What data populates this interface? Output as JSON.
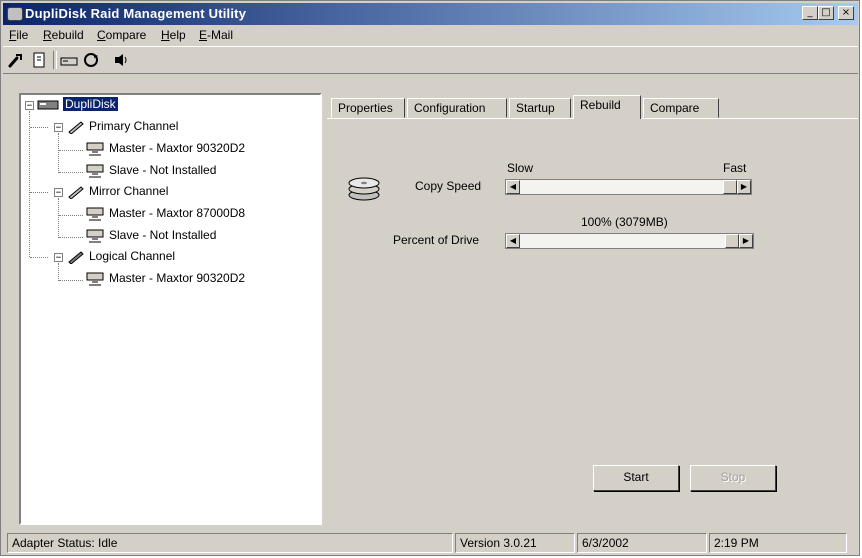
{
  "window": {
    "title": "DupliDisk Raid Management Utility",
    "minimize_glyph": "_",
    "maximize_glyph": "□",
    "close_glyph": "×"
  },
  "menu": [
    {
      "label": "File",
      "accel": "F",
      "rest": "ile"
    },
    {
      "label": "Rebuild",
      "accel": "R",
      "rest": "ebuild"
    },
    {
      "label": "Compare",
      "accel": "C",
      "rest": "ompare"
    },
    {
      "label": "Help",
      "accel": "H",
      "rest": "elp"
    },
    {
      "label": "E-Mail",
      "accel": "E",
      "rest": "-Mail"
    }
  ],
  "toolbar": {
    "icons": [
      "wrench-icon",
      "document-icon",
      "drive-icon",
      "refresh-icon",
      "speaker-icon"
    ]
  },
  "tree": {
    "root": "DupliDisk",
    "channels": [
      {
        "label": "Primary Channel",
        "children": [
          "Master - Maxtor 90320D2",
          "Slave - Not Installed"
        ]
      },
      {
        "label": "Mirror Channel",
        "children": [
          "Master - Maxtor 87000D8",
          "Slave - Not Installed"
        ]
      },
      {
        "label": "Logical Channel",
        "children": [
          "Master - Maxtor 90320D2"
        ]
      }
    ],
    "expander_glyph": "−"
  },
  "tabs": [
    {
      "label": "Properties"
    },
    {
      "label": "Configuration"
    },
    {
      "label": "Startup"
    },
    {
      "label": "Rebuild",
      "active": true
    },
    {
      "label": "Compare"
    }
  ],
  "rebuild": {
    "copy_speed_label": "Copy Speed",
    "slow_label": "Slow",
    "fast_label": "Fast",
    "copy_speed_fraction": 1.0,
    "percent_label": "Percent of Drive",
    "percent_value": "100%  (3079MB)",
    "percent_fraction": 1.0,
    "left_arrow": "◀",
    "right_arrow": "▶",
    "start_button": "Start",
    "stop_button": "Stop"
  },
  "status": {
    "adapter": "Adapter Status: Idle",
    "version": "Version 3.0.21",
    "date": "6/3/2002",
    "time": "2:19 PM"
  }
}
